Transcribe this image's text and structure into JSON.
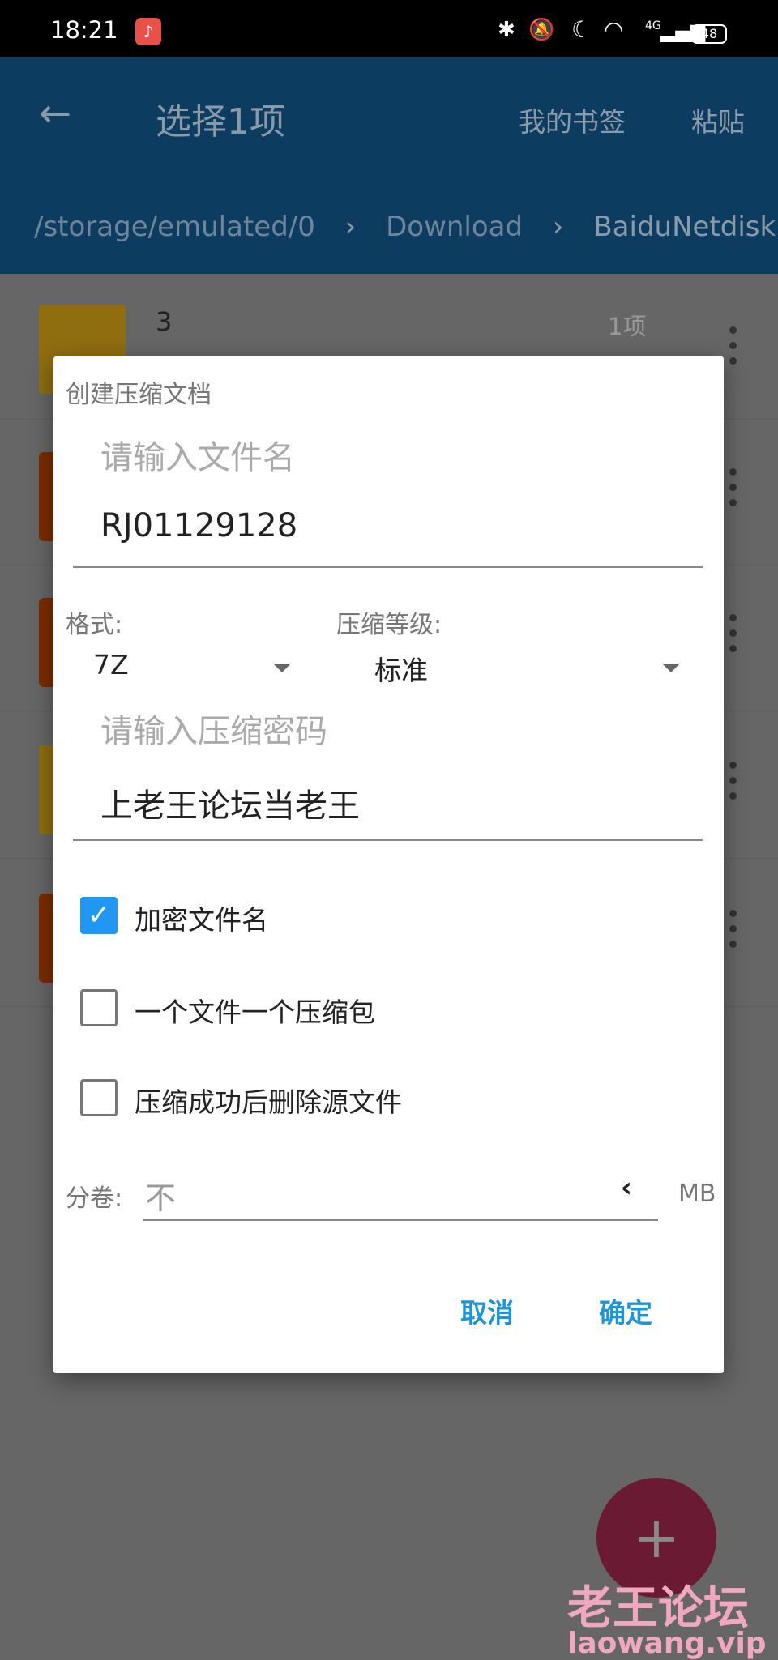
{
  "status_bar": {
    "time": "18:21",
    "battery": "48",
    "network": "4G",
    "icons": [
      "music-app-icon",
      "bluetooth-icon",
      "mute-icon",
      "moon-icon",
      "wifi-icon",
      "signal-icon",
      "battery-icon"
    ]
  },
  "app_bar": {
    "title": "选择1项",
    "bookmarks": "我的书签",
    "paste": "粘贴",
    "breadcrumb": [
      "/storage/emulated/0",
      "Download",
      "BaiduNetdisk"
    ]
  },
  "list": [
    {
      "name": "3",
      "info": "1项",
      "type": "folder"
    },
    {
      "type": "file"
    },
    {
      "type": "file"
    },
    {
      "type": "folder"
    },
    {
      "type": "file"
    }
  ],
  "dialog": {
    "title": "创建压缩文档",
    "filename_hint": "请输入文件名",
    "filename_value": "RJ01129128",
    "format_label": "格式:",
    "format_value": "7Z",
    "level_label": "压缩等级:",
    "level_value": "标准",
    "password_hint": "请输入压缩密码",
    "password_value": "上老王论坛当老王",
    "checkboxes": [
      {
        "label": "加密文件名",
        "checked": true
      },
      {
        "label": "一个文件一个压缩包",
        "checked": false
      },
      {
        "label": "压缩成功后删除源文件",
        "checked": false
      }
    ],
    "split_label": "分卷:",
    "split_value": "不",
    "split_unit": "MB",
    "cancel": "取消",
    "ok": "确定"
  },
  "fab": "+",
  "watermark": {
    "cn": "老王论坛",
    "url": "laowang.vip"
  },
  "colors": {
    "primary": "#2196F3",
    "accent": "#e91e63",
    "button_text": "#1e96d6"
  }
}
